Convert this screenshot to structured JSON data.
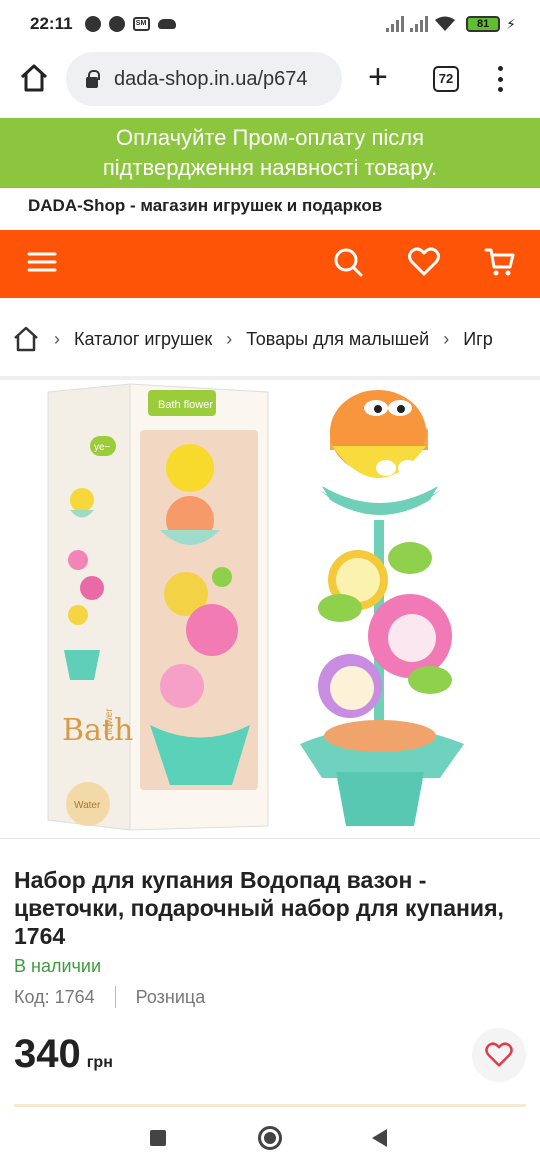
{
  "status_bar": {
    "time": "22:11",
    "sim_label": "SM",
    "battery": "81"
  },
  "browser": {
    "url": "dada-shop.in.ua/p674",
    "tab_count": "72"
  },
  "banner": {
    "line1": "Оплачуйте Пром-оплату після",
    "line2": "підтвердження наявності товару."
  },
  "shop": {
    "tagline": "DADA-Shop - магазин игрушек и подарков",
    "accent_color": "#fd5407",
    "banner_color": "#8cc63f"
  },
  "breadcrumb": {
    "items": [
      "Каталог игрушек",
      "Товары для малышей",
      "Игр"
    ]
  },
  "product": {
    "box_label_top": "Bath flower",
    "box_label_side": "Bath",
    "box_label_side2": "flower",
    "box_logo": "Water",
    "box_bubble": "ye~",
    "title": "Набор для купания Водопад вазон - цветочки, подарочный набор для купания, 1764",
    "availability": "В наличии",
    "code": "Код: 1764",
    "type": "Розница",
    "price": "340",
    "currency": "грн"
  },
  "icons": {
    "home": "home-icon",
    "search": "search-icon",
    "favorite": "heart-icon",
    "cart": "cart-icon",
    "menu": "hamburger-icon"
  }
}
